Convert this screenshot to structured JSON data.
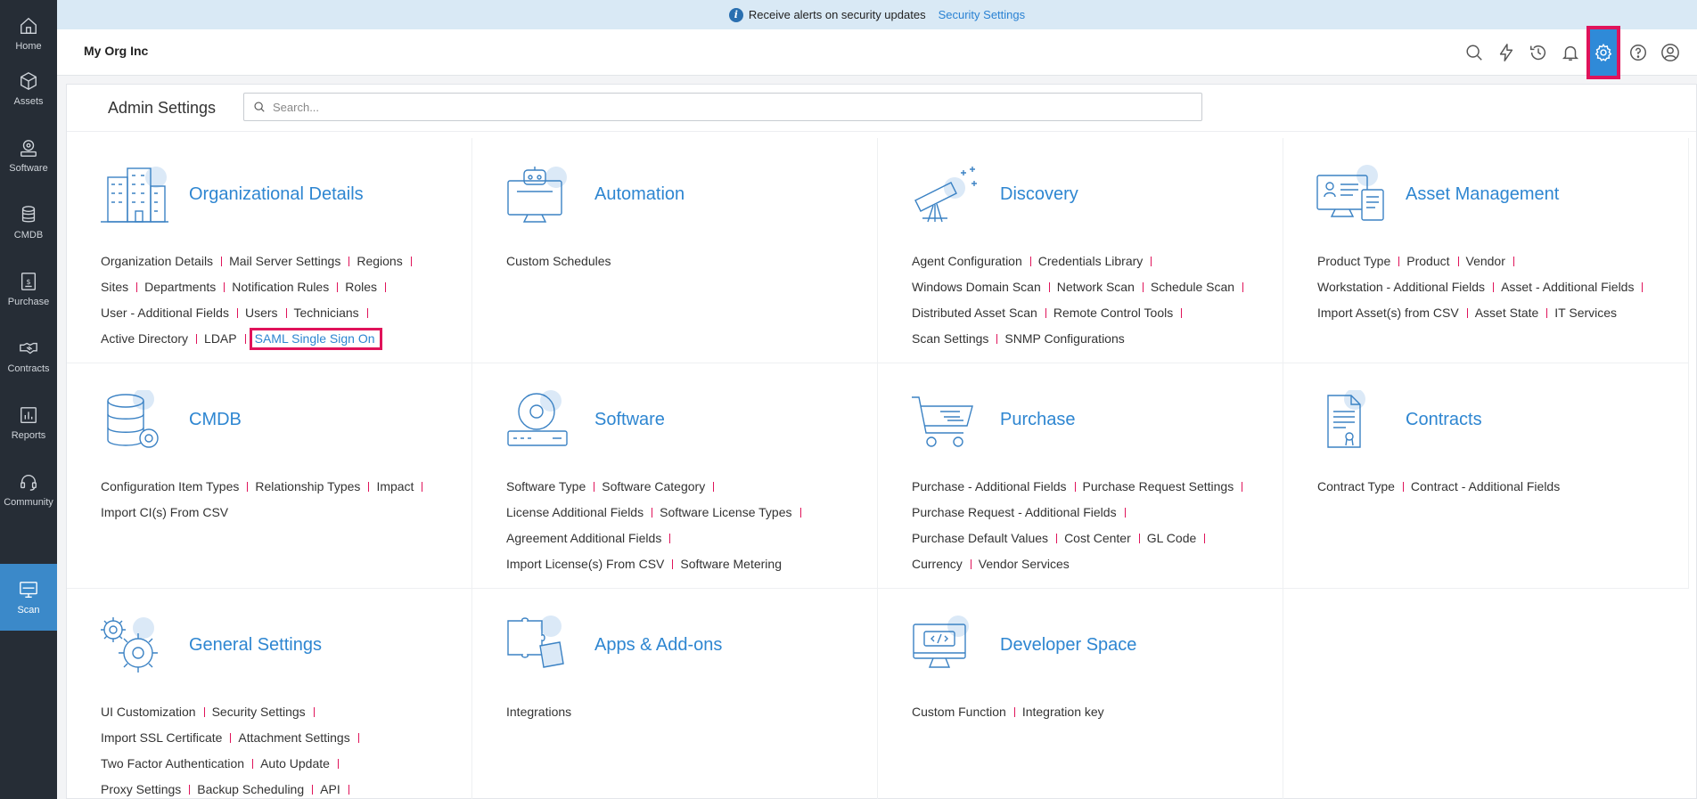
{
  "leftnav": {
    "items": [
      {
        "label": "Home",
        "icon": "home-icon"
      },
      {
        "label": "Assets",
        "icon": "cube-icon"
      },
      {
        "label": "Software",
        "icon": "software-icon"
      },
      {
        "label": "CMDB",
        "icon": "database-icon"
      },
      {
        "label": "Purchase",
        "icon": "purchase-icon"
      },
      {
        "label": "Contracts",
        "icon": "handshake-icon"
      },
      {
        "label": "Reports",
        "icon": "report-icon"
      },
      {
        "label": "Community",
        "icon": "headset-icon"
      },
      {
        "label": "Scan",
        "icon": "monitor-scan-icon",
        "active": true
      }
    ]
  },
  "banner": {
    "text": "Receive alerts on security updates",
    "link": "Security Settings"
  },
  "header": {
    "org": "My Org Inc",
    "icons": [
      "search-icon",
      "lightning-icon",
      "history-icon",
      "bell-icon",
      "gear-icon",
      "help-icon",
      "user-avatar-icon"
    ]
  },
  "page": {
    "title": "Admin Settings",
    "search_placeholder": "Search..."
  },
  "cards": [
    {
      "title": "Organizational Details",
      "icon": "building-icon",
      "rows": [
        [
          "Organization Details",
          "Mail Server Settings",
          "Regions"
        ],
        [
          "Sites",
          "Departments",
          "Notification Rules",
          "Roles"
        ],
        [
          "User - Additional Fields",
          "Users",
          "Technicians"
        ],
        [
          "Active Directory",
          "LDAP",
          "SAML Single Sign On"
        ]
      ]
    },
    {
      "title": "Automation",
      "icon": "robot-monitor-icon",
      "rows": [
        [
          "Custom Schedules"
        ]
      ]
    },
    {
      "title": "Discovery",
      "icon": "telescope-icon",
      "rows": [
        [
          "Agent Configuration",
          "Credentials Library"
        ],
        [
          "Windows Domain Scan",
          "Network Scan",
          "Schedule Scan"
        ],
        [
          "Distributed Asset Scan",
          "Remote Control Tools"
        ],
        [
          "Scan Settings",
          "SNMP Configurations"
        ]
      ]
    },
    {
      "title": "Asset Management",
      "icon": "asset-management-icon",
      "rows": [
        [
          "Product Type",
          "Product",
          "Vendor"
        ],
        [
          "Workstation - Additional Fields",
          "Asset - Additional Fields"
        ],
        [
          "Import Asset(s) from CSV",
          "Asset State",
          "IT Services"
        ]
      ]
    },
    {
      "title": "CMDB",
      "icon": "database-gear-icon",
      "rows": [
        [
          "Configuration Item Types",
          "Relationship Types",
          "Impact"
        ],
        [
          "Import CI(s) From CSV"
        ]
      ]
    },
    {
      "title": "Software",
      "icon": "disc-drive-icon",
      "rows": [
        [
          "Software Type",
          "Software Category"
        ],
        [
          "License Additional Fields",
          "Software License Types"
        ],
        [
          "Agreement Additional Fields"
        ],
        [
          "Import License(s) From CSV",
          "Software Metering"
        ]
      ]
    },
    {
      "title": "Purchase",
      "icon": "shopping-cart-icon",
      "rows": [
        [
          "Purchase - Additional Fields",
          "Purchase Request Settings"
        ],
        [
          "Purchase Request - Additional Fields"
        ],
        [
          "Purchase Default Values",
          "Cost Center",
          "GL Code"
        ],
        [
          "Currency",
          "Vendor Services"
        ]
      ]
    },
    {
      "title": "Contracts",
      "icon": "contract-document-icon",
      "rows": [
        [
          "Contract Type",
          "Contract - Additional Fields"
        ]
      ]
    },
    {
      "title": "General Settings",
      "icon": "gears-icon",
      "rows": [
        [
          "UI Customization",
          "Security Settings"
        ],
        [
          "Import SSL Certificate",
          "Attachment Settings"
        ],
        [
          "Two Factor Authentication",
          "Auto Update"
        ],
        [
          "Proxy Settings",
          "Backup Scheduling",
          "API"
        ]
      ]
    },
    {
      "title": "Apps & Add-ons",
      "icon": "puzzle-icon",
      "rows": [
        [
          "Integrations"
        ]
      ]
    },
    {
      "title": "Developer Space",
      "icon": "code-monitor-icon",
      "rows": [
        [
          "Custom Function",
          "Integration key"
        ]
      ]
    }
  ],
  "row_trailing_separators": {
    "0": [
      true,
      true,
      true,
      false
    ],
    "1": [
      false
    ],
    "2": [
      true,
      true,
      true,
      false
    ],
    "3": [
      true,
      true,
      false
    ],
    "4": [
      true,
      false
    ],
    "5": [
      true,
      true,
      true,
      false
    ],
    "6": [
      true,
      true,
      true,
      false
    ],
    "7": [
      false
    ],
    "8": [
      true,
      true,
      true,
      true
    ],
    "9": [
      false
    ],
    "10": [
      false
    ]
  },
  "highlight": {
    "card": 0,
    "row": 3,
    "item": 2
  }
}
